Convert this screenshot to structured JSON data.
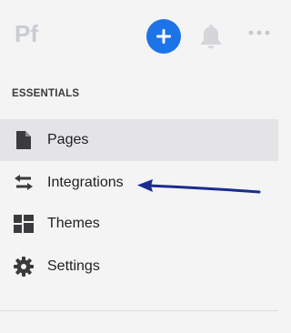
{
  "app": {
    "logo_text": "Pf"
  },
  "header": {
    "add_icon": "plus-icon",
    "bell_icon": "bell-icon",
    "more_icon": "ellipsis-icon",
    "accent_color": "#1d73e8"
  },
  "sidebar": {
    "section_title": "ESSENTIALS",
    "active_item": "Pages",
    "items": [
      {
        "label": "Pages",
        "icon": "document-icon"
      },
      {
        "label": "Integrations",
        "icon": "swap-arrows-icon"
      },
      {
        "label": "Themes",
        "icon": "layout-grid-icon"
      },
      {
        "label": "Settings",
        "icon": "gear-icon"
      }
    ]
  },
  "annotation": {
    "type": "arrow",
    "points_to": "Integrations",
    "color": "#1a2c8f"
  }
}
